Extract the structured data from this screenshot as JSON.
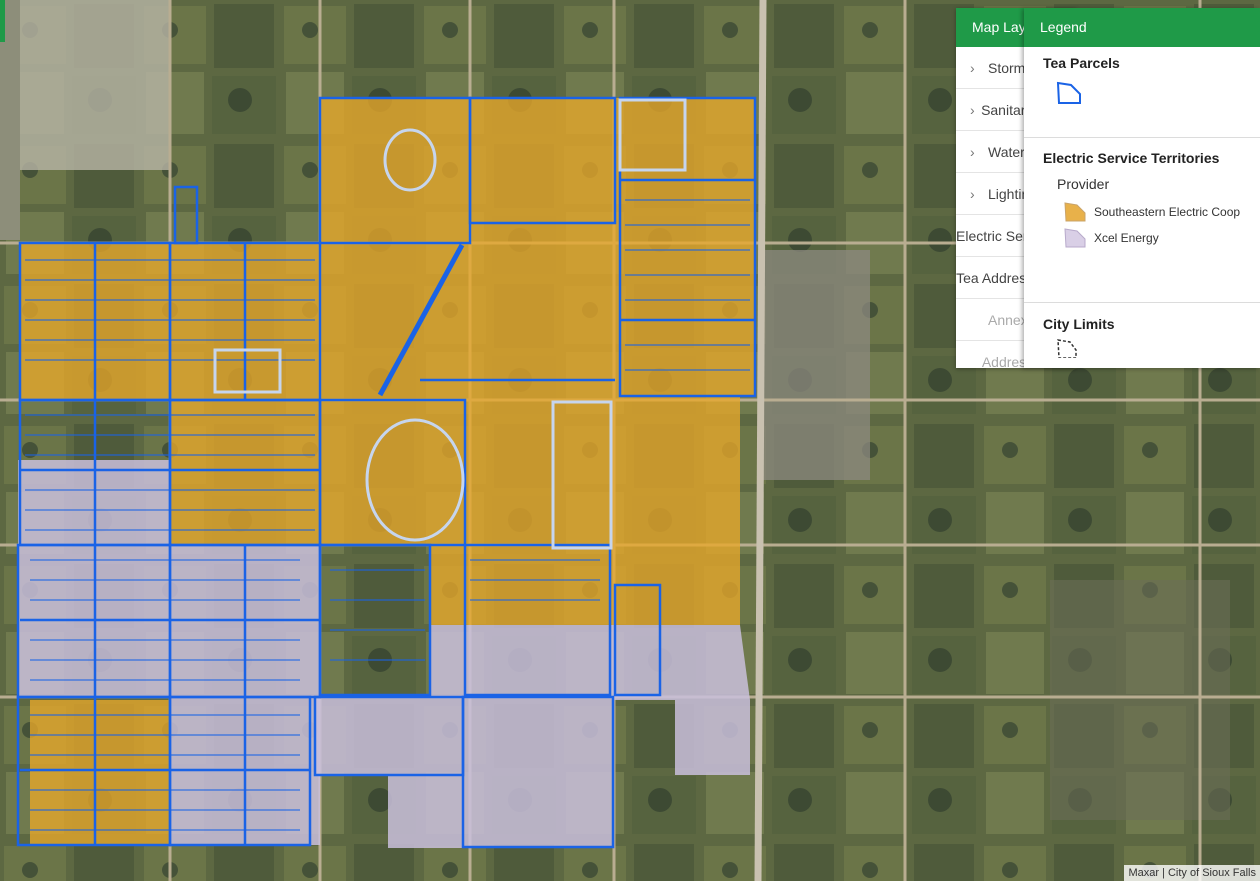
{
  "map": {
    "attribution": "Maxar | City of Sioux Falls",
    "colors": {
      "coop": "#e8a82a",
      "xcel": "#c9bfdc",
      "parcel": "#1a63e6",
      "parcel_light": "#c6d5ee"
    }
  },
  "layers_panel": {
    "title": "Map Layers",
    "items": [
      {
        "label": "Storm Sewer",
        "expandable": true,
        "disabled": false
      },
      {
        "label": "Sanitary Sewer",
        "expandable": true,
        "disabled": false
      },
      {
        "label": "Water",
        "expandable": true,
        "disabled": false
      },
      {
        "label": "Lighting",
        "expandable": true,
        "disabled": false
      },
      {
        "label": "Electric Service Territories",
        "expandable": false,
        "disabled": false
      },
      {
        "label": "Tea Address Points",
        "expandable": false,
        "disabled": false
      },
      {
        "label": "Annexations",
        "expandable": false,
        "disabled": true
      },
      {
        "label": "Address Points",
        "expandable": false,
        "disabled": true
      }
    ]
  },
  "legend": {
    "title": "Legend",
    "tea_parcels": {
      "title": "Tea Parcels",
      "icon": "parcel-outline-icon"
    },
    "electric": {
      "title": "Electric Service Territories",
      "subtitle": "Provider",
      "items": [
        {
          "label": "Southeastern Electric Coop",
          "color": "#e8b14a"
        },
        {
          "label": "Xcel Energy",
          "color": "#d9cfe6"
        }
      ]
    },
    "city_limits": {
      "title": "City Limits",
      "icon": "dashed-outline-icon"
    }
  }
}
